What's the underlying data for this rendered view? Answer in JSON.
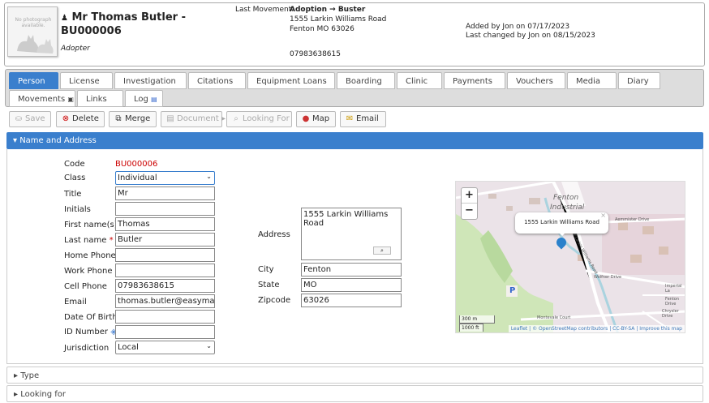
{
  "header": {
    "photo_text": "No photograph available.",
    "name": "Mr Thomas Butler - BU000006",
    "role": "Adopter",
    "last_movement_label": "Last Movement:",
    "last_movement_value": "Adoption → Buster",
    "address_line1": "1555 Larkin Williams Road",
    "address_line2": "Fenton MO 63026",
    "phone": "07983638615",
    "added": "Added by Jon on 07/17/2023",
    "changed": "Last changed by Jon on 08/15/2023"
  },
  "tabs": [
    {
      "label": "Person"
    },
    {
      "label": "License"
    },
    {
      "label": "Investigation"
    },
    {
      "label": "Citations"
    },
    {
      "label": "Equipment Loans"
    },
    {
      "label": "Boarding"
    },
    {
      "label": "Clinic"
    },
    {
      "label": "Payments"
    },
    {
      "label": "Vouchers"
    },
    {
      "label": "Media"
    },
    {
      "label": "Diary"
    },
    {
      "label": "Movements"
    },
    {
      "label": "Links"
    },
    {
      "label": "Log"
    }
  ],
  "toolbar": {
    "save": "Save",
    "delete": "Delete",
    "merge": "Merge",
    "document": "Document",
    "looking_for": "Looking For",
    "map": "Map",
    "email": "Email"
  },
  "section_title": "Name and Address",
  "form": {
    "code_label": "Code",
    "code": "BU000006",
    "class_label": "Class",
    "class": "Individual",
    "title_label": "Title",
    "title": "Mr",
    "initials_label": "Initials",
    "initials": "",
    "first_label": "First name(s)",
    "first": "Thomas",
    "last_label": "Last name",
    "last": "Butler",
    "home_label": "Home Phone",
    "home": "",
    "work_label": "Work Phone",
    "work": "",
    "cell_label": "Cell Phone",
    "cell": "07983638615",
    "email_label": "Email",
    "email": "thomas.butler@easymail.com",
    "dob_label": "Date Of Birth",
    "dob": "",
    "id_label": "ID Number",
    "id": "",
    "juris_label": "Jurisdiction",
    "juris": "Local",
    "address_label": "Address",
    "address": "1555 Larkin Williams Road",
    "city_label": "City",
    "city": "Fenton",
    "state_label": "State",
    "state": "MO",
    "zip_label": "Zipcode",
    "zip": "63026"
  },
  "map": {
    "popup": "1555 Larkin Williams Road",
    "zoom_in": "+",
    "zoom_out": "−",
    "scale_m": "300 m",
    "scale_ft": "1000 ft",
    "attribution": "Leaflet | © OpenStreetMap contributors | CC-BY-SA | Improve this map",
    "place_fenton": "Fenton",
    "place_industrial": "Industrial",
    "street_1": "Aemmister Drive",
    "street_2": "Wolfner Drive",
    "street_3": "Imperial La",
    "street_4": "Chrysler Drive",
    "street_5": "Montevale Court",
    "street_6": "Fenton Drive",
    "street_7": "Larkin Williams Road",
    "parking": "P"
  },
  "collapsed": [
    "Type",
    "Looking for"
  ],
  "colors": {
    "accent": "#3a7fcd",
    "required": "#cc0000"
  }
}
